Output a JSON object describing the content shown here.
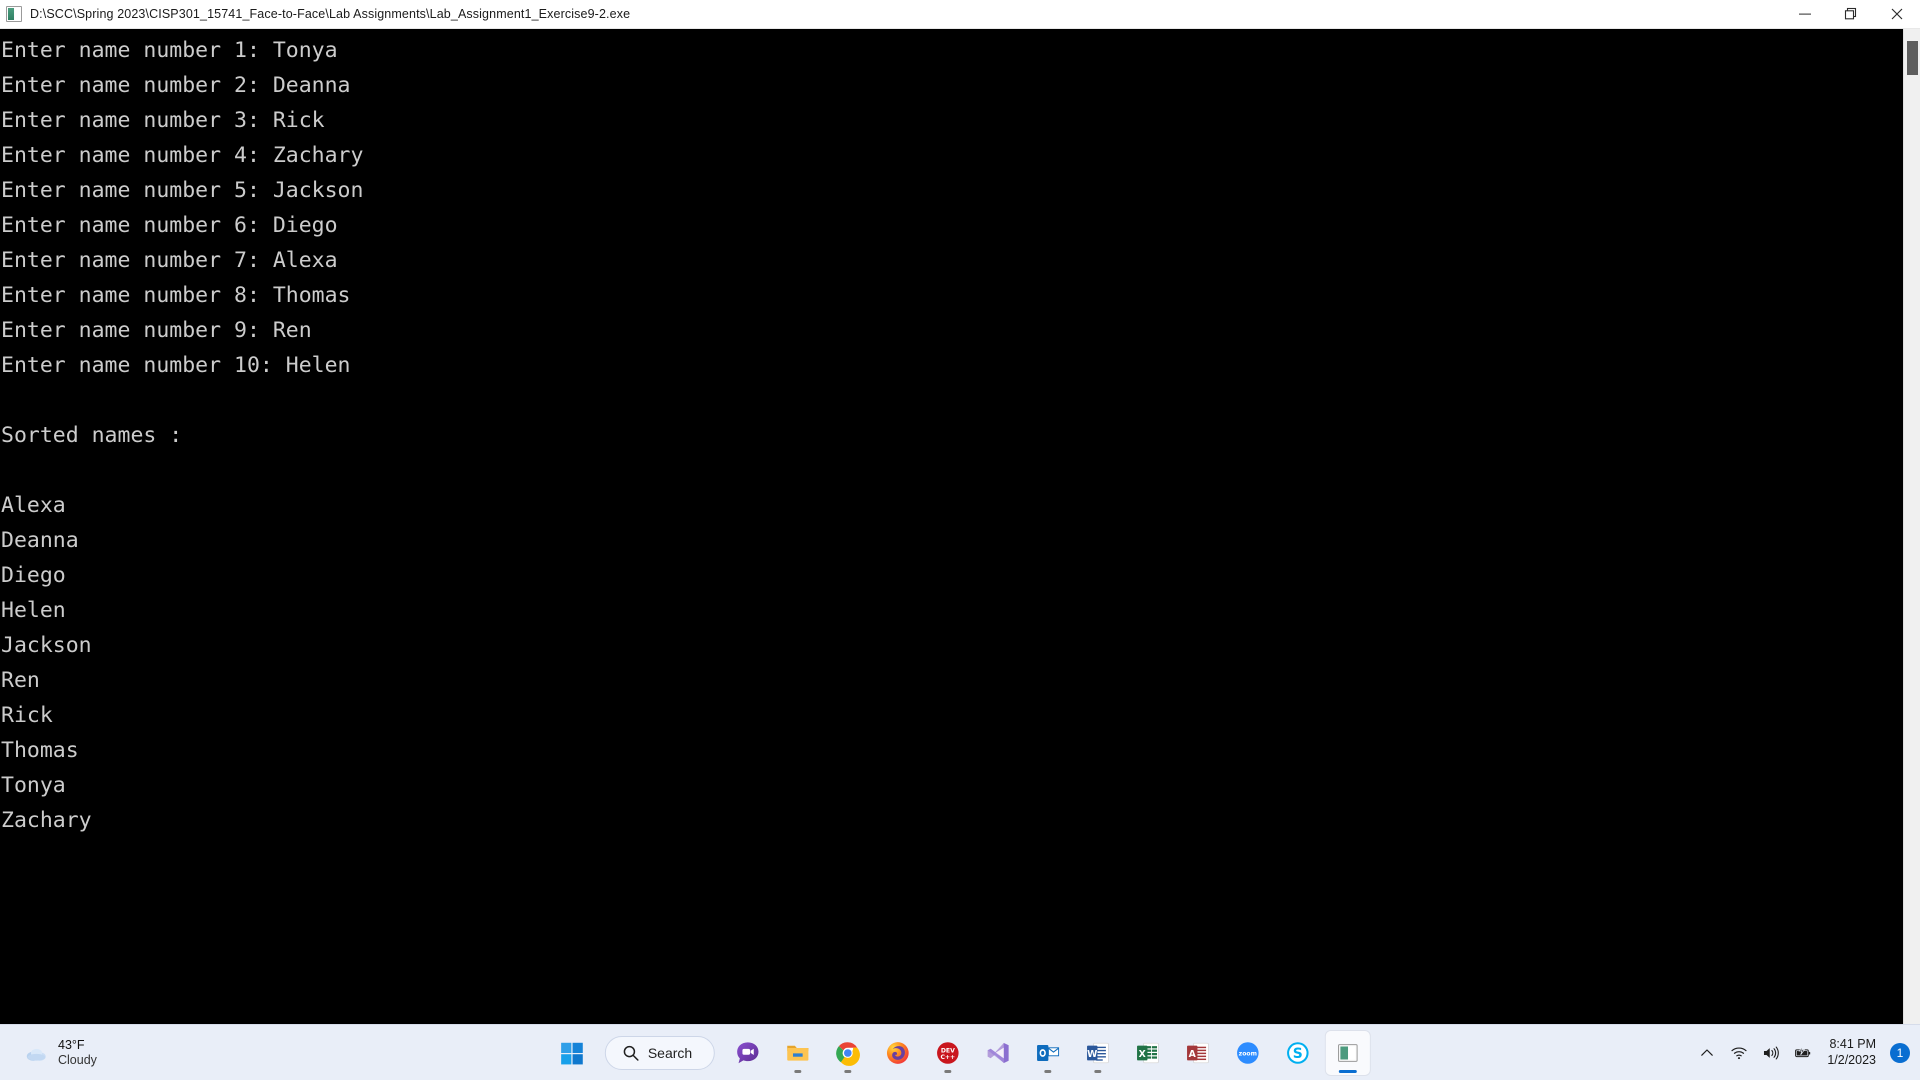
{
  "window": {
    "title": "D:\\SCC\\Spring 2023\\CISP301_15741_Face-to-Face\\Lab Assignments\\Lab_Assignment1_Exercise9-2.exe",
    "app_icon": "console-app-icon",
    "controls": {
      "minimize_label": "Minimize",
      "restore_label": "Restore",
      "close_label": "Close"
    }
  },
  "console": {
    "foreground_color": "#cccccc",
    "background_color": "#000000",
    "lines": [
      "Enter name number 1: Tonya",
      "Enter name number 2: Deanna",
      "Enter name number 3: Rick",
      "Enter name number 4: Zachary",
      "Enter name number 5: Jackson",
      "Enter name number 6: Diego",
      "Enter name number 7: Alexa",
      "Enter name number 8: Thomas",
      "Enter name number 9: Ren",
      "Enter name number 10: Helen",
      "",
      "Sorted names :",
      "",
      "Alexa",
      "Deanna",
      "Diego",
      "Helen",
      "Jackson",
      "Ren",
      "Rick",
      "Thomas",
      "Tonya",
      "Zachary"
    ]
  },
  "taskbar": {
    "weather": {
      "temperature": "43°F",
      "condition": "Cloudy",
      "icon": "cloud-icon"
    },
    "search": {
      "label": "Search",
      "icon": "search-icon"
    },
    "start": {
      "label": "Start",
      "icon": "windows-logo-icon"
    },
    "apps": [
      {
        "name": "chat",
        "label": "Chat",
        "icon": "chat-video-icon",
        "running": false,
        "active": false
      },
      {
        "name": "file-explorer",
        "label": "File Explorer",
        "icon": "folder-icon",
        "running": true,
        "active": false
      },
      {
        "name": "google-chrome",
        "label": "Google Chrome",
        "icon": "chrome-icon",
        "running": true,
        "active": false
      },
      {
        "name": "firefox",
        "label": "Firefox",
        "icon": "firefox-icon",
        "running": false,
        "active": false
      },
      {
        "name": "dev-cpp",
        "label": "Dev-C++",
        "icon": "devcpp-icon",
        "running": true,
        "active": false
      },
      {
        "name": "visual-studio",
        "label": "Visual Studio",
        "icon": "visual-studio-icon",
        "running": false,
        "active": false
      },
      {
        "name": "outlook",
        "label": "Outlook",
        "icon": "outlook-icon",
        "running": true,
        "active": false
      },
      {
        "name": "word",
        "label": "Word",
        "icon": "word-icon",
        "running": true,
        "active": false
      },
      {
        "name": "excel",
        "label": "Excel",
        "icon": "excel-icon",
        "running": false,
        "active": false
      },
      {
        "name": "access",
        "label": "Access",
        "icon": "access-icon",
        "running": false,
        "active": false
      },
      {
        "name": "zoom",
        "label": "zoom",
        "icon": "zoom-icon",
        "running": false,
        "active": false
      },
      {
        "name": "skype",
        "label": "Skype",
        "icon": "skype-icon",
        "running": false,
        "active": false
      },
      {
        "name": "console-app",
        "label": "Lab_Assignment1_Exercise9-2",
        "icon": "console-app-icon",
        "running": true,
        "active": true
      }
    ],
    "tray": {
      "show_hidden_label": "Show hidden icons",
      "network_label": "Network",
      "volume_label": "Volume",
      "battery_label": "Battery charging",
      "time": "8:41 PM",
      "date": "1/2/2023",
      "notification_count": "1"
    }
  },
  "colors": {
    "accent": "#0a6ed1",
    "taskbar_bg": "#e9eef8",
    "titlebar_bg": "#ffffff"
  }
}
